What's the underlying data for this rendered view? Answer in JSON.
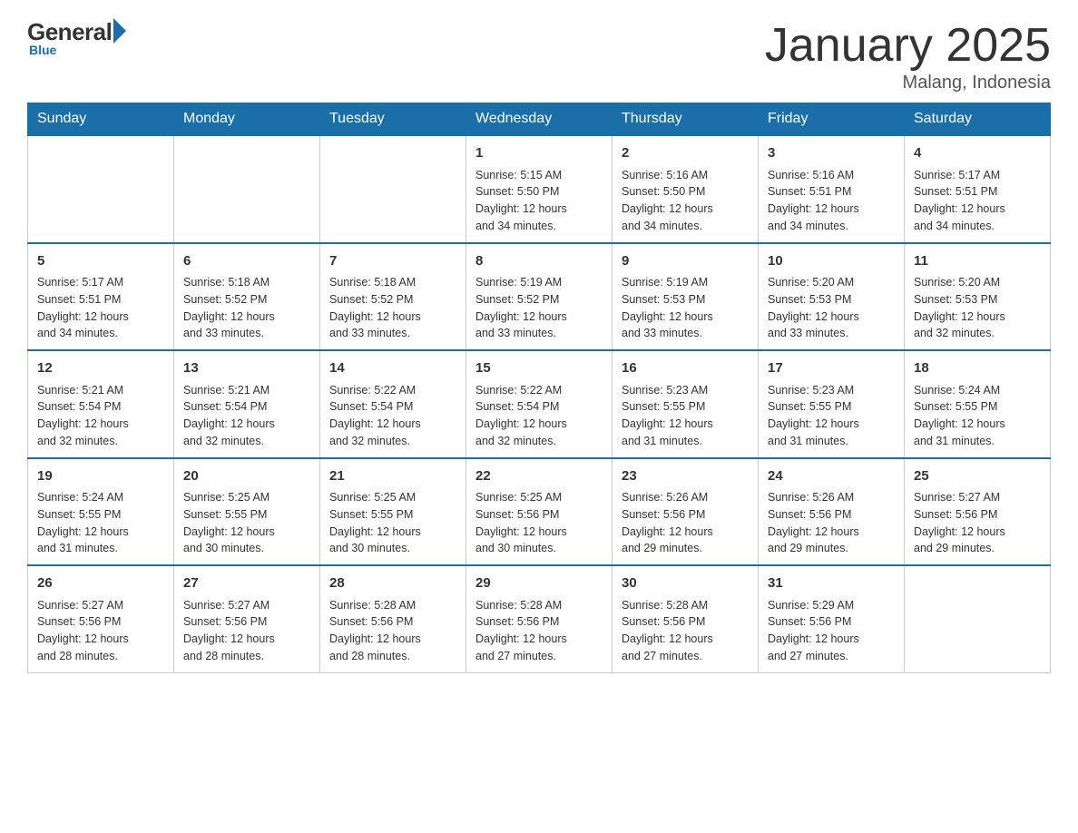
{
  "logo": {
    "general": "General",
    "blue": "Blue",
    "underline": "Blue"
  },
  "header": {
    "title": "January 2025",
    "location": "Malang, Indonesia"
  },
  "weekdays": [
    "Sunday",
    "Monday",
    "Tuesday",
    "Wednesday",
    "Thursday",
    "Friday",
    "Saturday"
  ],
  "weeks": [
    [
      {
        "day": "",
        "info": ""
      },
      {
        "day": "",
        "info": ""
      },
      {
        "day": "",
        "info": ""
      },
      {
        "day": "1",
        "info": "Sunrise: 5:15 AM\nSunset: 5:50 PM\nDaylight: 12 hours\nand 34 minutes."
      },
      {
        "day": "2",
        "info": "Sunrise: 5:16 AM\nSunset: 5:50 PM\nDaylight: 12 hours\nand 34 minutes."
      },
      {
        "day": "3",
        "info": "Sunrise: 5:16 AM\nSunset: 5:51 PM\nDaylight: 12 hours\nand 34 minutes."
      },
      {
        "day": "4",
        "info": "Sunrise: 5:17 AM\nSunset: 5:51 PM\nDaylight: 12 hours\nand 34 minutes."
      }
    ],
    [
      {
        "day": "5",
        "info": "Sunrise: 5:17 AM\nSunset: 5:51 PM\nDaylight: 12 hours\nand 34 minutes."
      },
      {
        "day": "6",
        "info": "Sunrise: 5:18 AM\nSunset: 5:52 PM\nDaylight: 12 hours\nand 33 minutes."
      },
      {
        "day": "7",
        "info": "Sunrise: 5:18 AM\nSunset: 5:52 PM\nDaylight: 12 hours\nand 33 minutes."
      },
      {
        "day": "8",
        "info": "Sunrise: 5:19 AM\nSunset: 5:52 PM\nDaylight: 12 hours\nand 33 minutes."
      },
      {
        "day": "9",
        "info": "Sunrise: 5:19 AM\nSunset: 5:53 PM\nDaylight: 12 hours\nand 33 minutes."
      },
      {
        "day": "10",
        "info": "Sunrise: 5:20 AM\nSunset: 5:53 PM\nDaylight: 12 hours\nand 33 minutes."
      },
      {
        "day": "11",
        "info": "Sunrise: 5:20 AM\nSunset: 5:53 PM\nDaylight: 12 hours\nand 32 minutes."
      }
    ],
    [
      {
        "day": "12",
        "info": "Sunrise: 5:21 AM\nSunset: 5:54 PM\nDaylight: 12 hours\nand 32 minutes."
      },
      {
        "day": "13",
        "info": "Sunrise: 5:21 AM\nSunset: 5:54 PM\nDaylight: 12 hours\nand 32 minutes."
      },
      {
        "day": "14",
        "info": "Sunrise: 5:22 AM\nSunset: 5:54 PM\nDaylight: 12 hours\nand 32 minutes."
      },
      {
        "day": "15",
        "info": "Sunrise: 5:22 AM\nSunset: 5:54 PM\nDaylight: 12 hours\nand 32 minutes."
      },
      {
        "day": "16",
        "info": "Sunrise: 5:23 AM\nSunset: 5:55 PM\nDaylight: 12 hours\nand 31 minutes."
      },
      {
        "day": "17",
        "info": "Sunrise: 5:23 AM\nSunset: 5:55 PM\nDaylight: 12 hours\nand 31 minutes."
      },
      {
        "day": "18",
        "info": "Sunrise: 5:24 AM\nSunset: 5:55 PM\nDaylight: 12 hours\nand 31 minutes."
      }
    ],
    [
      {
        "day": "19",
        "info": "Sunrise: 5:24 AM\nSunset: 5:55 PM\nDaylight: 12 hours\nand 31 minutes."
      },
      {
        "day": "20",
        "info": "Sunrise: 5:25 AM\nSunset: 5:55 PM\nDaylight: 12 hours\nand 30 minutes."
      },
      {
        "day": "21",
        "info": "Sunrise: 5:25 AM\nSunset: 5:55 PM\nDaylight: 12 hours\nand 30 minutes."
      },
      {
        "day": "22",
        "info": "Sunrise: 5:25 AM\nSunset: 5:56 PM\nDaylight: 12 hours\nand 30 minutes."
      },
      {
        "day": "23",
        "info": "Sunrise: 5:26 AM\nSunset: 5:56 PM\nDaylight: 12 hours\nand 29 minutes."
      },
      {
        "day": "24",
        "info": "Sunrise: 5:26 AM\nSunset: 5:56 PM\nDaylight: 12 hours\nand 29 minutes."
      },
      {
        "day": "25",
        "info": "Sunrise: 5:27 AM\nSunset: 5:56 PM\nDaylight: 12 hours\nand 29 minutes."
      }
    ],
    [
      {
        "day": "26",
        "info": "Sunrise: 5:27 AM\nSunset: 5:56 PM\nDaylight: 12 hours\nand 28 minutes."
      },
      {
        "day": "27",
        "info": "Sunrise: 5:27 AM\nSunset: 5:56 PM\nDaylight: 12 hours\nand 28 minutes."
      },
      {
        "day": "28",
        "info": "Sunrise: 5:28 AM\nSunset: 5:56 PM\nDaylight: 12 hours\nand 28 minutes."
      },
      {
        "day": "29",
        "info": "Sunrise: 5:28 AM\nSunset: 5:56 PM\nDaylight: 12 hours\nand 27 minutes."
      },
      {
        "day": "30",
        "info": "Sunrise: 5:28 AM\nSunset: 5:56 PM\nDaylight: 12 hours\nand 27 minutes."
      },
      {
        "day": "31",
        "info": "Sunrise: 5:29 AM\nSunset: 5:56 PM\nDaylight: 12 hours\nand 27 minutes."
      },
      {
        "day": "",
        "info": ""
      }
    ]
  ]
}
